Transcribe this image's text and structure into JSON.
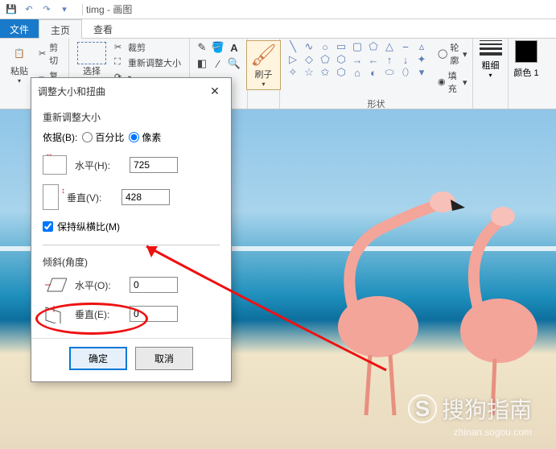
{
  "titlebar": {
    "filename": "timg",
    "app": "画图"
  },
  "tabs": {
    "file": "文件",
    "home": "主页",
    "view": "查看"
  },
  "ribbon": {
    "paste": "粘贴",
    "cut": "剪切",
    "copy": "复制",
    "select": "选择",
    "crop": "裁剪",
    "resize": "重新调整大小",
    "brush": "刷子",
    "outline": "轮廓",
    "fill": "填充",
    "shapes_label": "形状",
    "stroke": "粗细",
    "color1": "颜色 1"
  },
  "dialog": {
    "title": "调整大小和扭曲",
    "resize_section": "重新调整大小",
    "by": "依据(B):",
    "percent": "百分比",
    "pixels": "像素",
    "horizontal": "水平(H):",
    "vertical": "垂直(V):",
    "h_value": "725",
    "v_value": "428",
    "aspect": "保持纵横比(M)",
    "skew_section": "倾斜(角度)",
    "skew_h": "水平(O):",
    "skew_v": "垂直(E):",
    "skew_h_val": "0",
    "skew_v_val": "0",
    "ok": "确定",
    "cancel": "取消"
  },
  "watermark": {
    "brand": "搜狗指南",
    "url": "zhinan.sogou.com"
  }
}
